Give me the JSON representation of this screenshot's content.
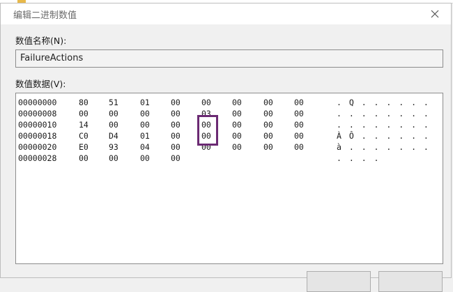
{
  "dialog": {
    "title": "编辑二进制数值",
    "value_name_label": "数值名称(N):",
    "value_name": "FailureActions",
    "value_data_label": "数值数据(V):"
  },
  "hex": {
    "rows": [
      {
        "addr": "00000000",
        "bytes": [
          "80",
          "51",
          "01",
          "00",
          "00",
          "00",
          "00",
          "00"
        ],
        "ascii": ". Q . . . . . ."
      },
      {
        "addr": "00000008",
        "bytes": [
          "00",
          "00",
          "00",
          "00",
          "03",
          "00",
          "00",
          "00"
        ],
        "ascii": ". . . . . . . ."
      },
      {
        "addr": "00000010",
        "bytes": [
          "14",
          "00",
          "00",
          "00",
          "00",
          "00",
          "00",
          "00"
        ],
        "ascii": ". . . . . . . ."
      },
      {
        "addr": "00000018",
        "bytes": [
          "C0",
          "D4",
          "01",
          "00",
          "00",
          "00",
          "00",
          "00"
        ],
        "ascii": "À Ô . . . . . ."
      },
      {
        "addr": "00000020",
        "bytes": [
          "E0",
          "93",
          "04",
          "00",
          "00",
          "00",
          "00",
          "00"
        ],
        "ascii": "à . . . . . . ."
      },
      {
        "addr": "00000028",
        "bytes": [
          "00",
          "00",
          "00",
          "00"
        ],
        "ascii": ". . . ."
      }
    ]
  },
  "colors": {
    "highlight": "#6b2a73",
    "underlying_folder": "#e8b94a"
  },
  "icons": {
    "close": "close-icon"
  }
}
